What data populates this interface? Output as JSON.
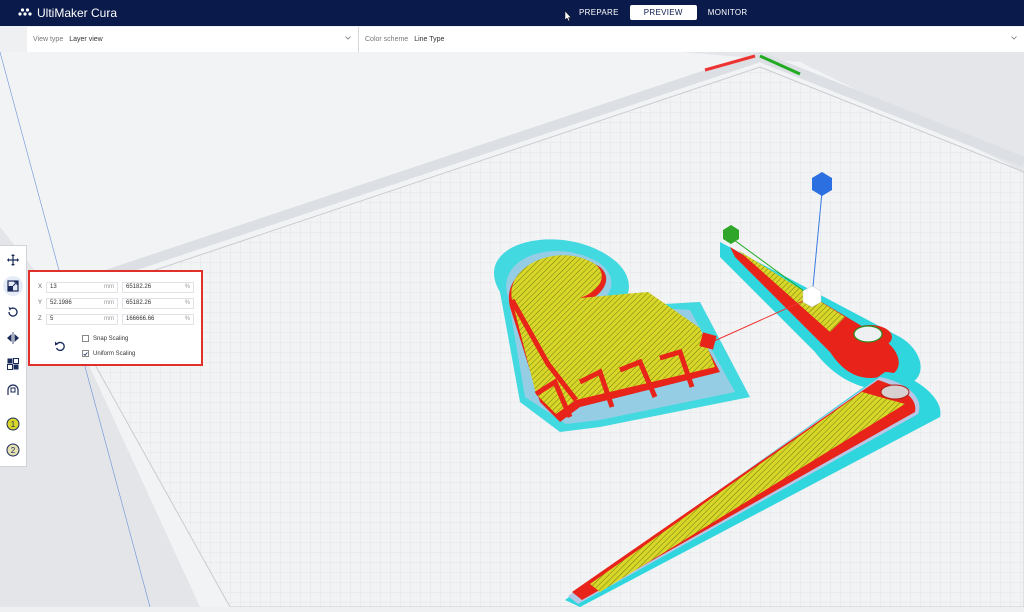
{
  "header": {
    "app_name": "UltiMaker Cura",
    "stages": [
      {
        "label": "PREPARE",
        "active": false
      },
      {
        "label": "PREVIEW",
        "active": true
      },
      {
        "label": "MONITOR",
        "active": false
      }
    ]
  },
  "view_options": {
    "view_type_label": "View type",
    "view_type_value": "Layer view",
    "color_scheme_label": "Color scheme",
    "color_scheme_value": "Line Type"
  },
  "scale_panel": {
    "rows": [
      {
        "axis": "X",
        "mm": "13",
        "mm_unit": "mm",
        "percent": "65182.26",
        "percent_unit": "%"
      },
      {
        "axis": "Y",
        "mm": "52.1986",
        "mm_unit": "mm",
        "percent": "65182.26",
        "percent_unit": "%"
      },
      {
        "axis": "Z",
        "mm": "5",
        "mm_unit": "mm",
        "percent": "166666.66",
        "percent_unit": "%"
      }
    ],
    "snap_scaling_label": "Snap Scaling",
    "snap_scaling_checked": false,
    "uniform_scaling_label": "Uniform Scaling",
    "uniform_scaling_checked": true
  },
  "colors": {
    "header_bg": "#0a1a4a",
    "wall_red": "#e8231a",
    "infill_yellow": "#d8d629",
    "skirt_cyan": "#2fd6de",
    "highlight_border": "#e0302a"
  }
}
